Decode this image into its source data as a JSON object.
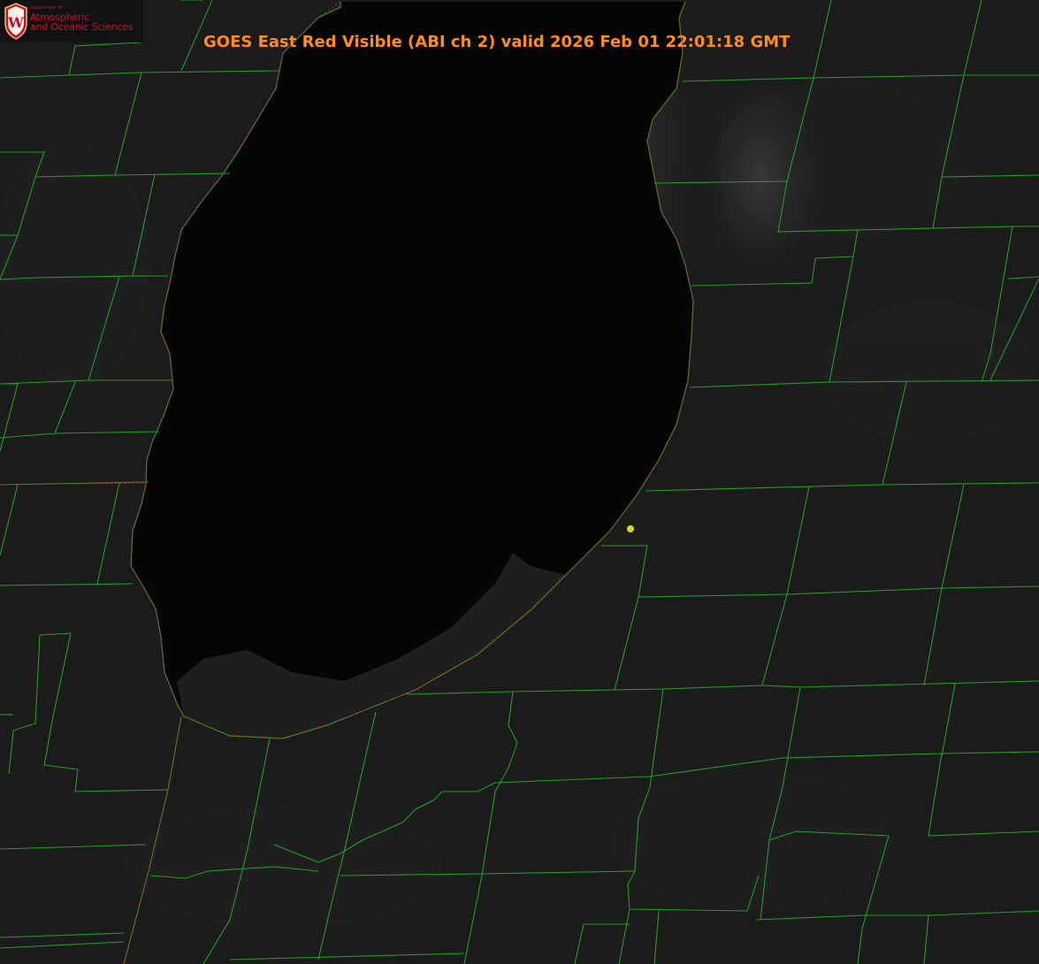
{
  "title": "GOES East Red Visible (ABI ch 2) valid 2026 Feb 01 22:01:18 GMT",
  "logo": {
    "department": "Department of",
    "line1": "Atmospheric",
    "line2": "and Oceanic Sciences",
    "crest_letter": "W"
  },
  "colors": {
    "title": "#ff8c1a",
    "county_lines": "#1f9e1f",
    "state_lines": "#d02020",
    "lake": "#050505",
    "land": "#1c1c1c",
    "station_marker": "#d9d92a",
    "logo_red": "#c8102e"
  },
  "icons": [
    "university-crest-icon",
    "station-marker-icon"
  ]
}
